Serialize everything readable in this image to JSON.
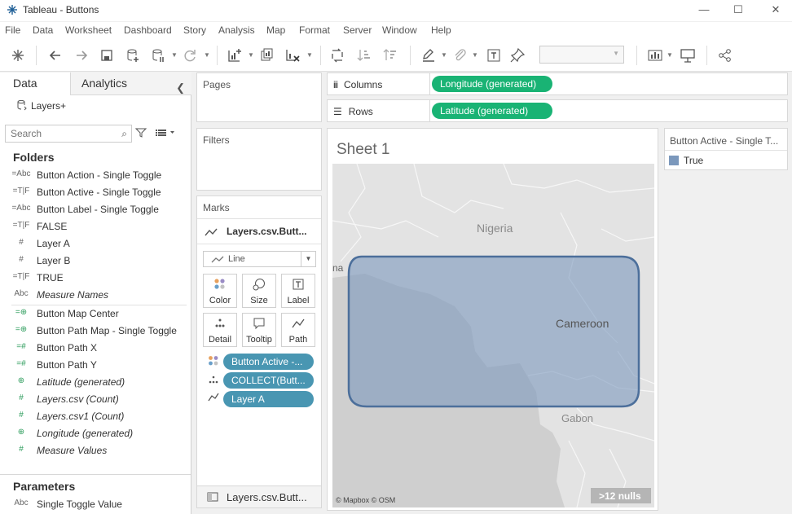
{
  "window": {
    "title": "Tableau - Buttons",
    "minimize": "—",
    "maximize": "☐",
    "close": "✕"
  },
  "menu": [
    "File",
    "Data",
    "Worksheet",
    "Dashboard",
    "Story",
    "Analysis",
    "Map",
    "Format",
    "Server",
    "Window",
    "Help"
  ],
  "data_pane": {
    "tabs": {
      "data": "Data",
      "analytics": "Analytics"
    },
    "datasource": "Layers+",
    "search_placeholder": "Search",
    "folders_title": "Folders",
    "fields": [
      {
        "icon": "=Abc",
        "name": "Button Action - Single Toggle",
        "italic": false
      },
      {
        "icon": "=T|F",
        "name": "Button Active - Single Toggle",
        "italic": false
      },
      {
        "icon": "=Abc",
        "name": "Button Label - Single Toggle",
        "italic": false
      },
      {
        "icon": "=T|F",
        "name": "FALSE",
        "italic": false
      },
      {
        "icon": "#",
        "name": "Layer A",
        "italic": false
      },
      {
        "icon": "#",
        "name": "Layer B",
        "italic": false
      },
      {
        "icon": "=T|F",
        "name": "TRUE",
        "italic": false
      },
      {
        "icon": "Abc",
        "name": "Measure Names",
        "italic": true
      }
    ],
    "measures": [
      {
        "icon": "=globe",
        "name": "Button Map Center",
        "italic": false
      },
      {
        "icon": "=globe",
        "name": "Button Path Map - Single Toggle",
        "italic": false
      },
      {
        "icon": "=#",
        "name": "Button Path X",
        "italic": false
      },
      {
        "icon": "=#",
        "name": "Button Path Y",
        "italic": false
      },
      {
        "icon": "globe",
        "name": "Latitude (generated)",
        "italic": true
      },
      {
        "icon": "#",
        "name": "Layers.csv (Count)",
        "italic": true
      },
      {
        "icon": "#",
        "name": "Layers.csv1 (Count)",
        "italic": true
      },
      {
        "icon": "globe",
        "name": "Longitude (generated)",
        "italic": true
      },
      {
        "icon": "#",
        "name": "Measure Values",
        "italic": true
      }
    ],
    "parameters_title": "Parameters",
    "parameters": [
      {
        "icon": "Abc",
        "name": "Single Toggle Value"
      }
    ]
  },
  "cards": {
    "pages": "Pages",
    "filters": "Filters",
    "marks": "Marks"
  },
  "marks": {
    "layer": "Layers.csv.Butt...",
    "type": "Line",
    "buttons": {
      "color": "Color",
      "size": "Size",
      "label": "Label",
      "detail": "Detail",
      "tooltip": "Tooltip",
      "path": "Path"
    },
    "pills": [
      "Button Active -...",
      "COLLECT(Butt...",
      "Layer A"
    ]
  },
  "sheet_tab": "Layers.csv.Butt...",
  "shelves": {
    "columns_label": "Columns",
    "columns_pill": "Longitude (generated)",
    "rows_label": "Rows",
    "rows_pill": "Latitude (generated)"
  },
  "view": {
    "sheet_title": "Sheet 1",
    "labels": {
      "nigeria": "Nigeria",
      "cameroon": "Cameroon",
      "gabon": "Gabon",
      "partial": "na"
    },
    "attribution": "© Mapbox © OSM",
    "nulls": ">12 nulls",
    "fill_color": "#7b98bc",
    "stroke_color": "#4c6f9b"
  },
  "legend": {
    "title": "Button Active - Single T...",
    "items": [
      {
        "label": "True",
        "color": "#7b98bc"
      }
    ]
  }
}
